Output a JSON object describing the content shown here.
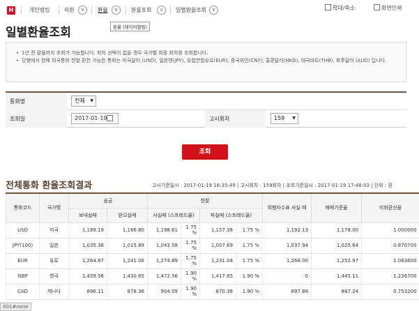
{
  "breadcrumb": {
    "home_icon": "H",
    "items": [
      "개인뱅킹",
      "외환",
      "환율",
      "환율조회",
      "일별환율조회"
    ]
  },
  "tools": {
    "print_zoom": "확대/축소",
    "print": "화면인쇄"
  },
  "tooltip": "환율 (레이어열림)",
  "page_title": "일별환율조회",
  "notices": [
    "1년 전 환율까지 조회가 가능합니다. 회차 선택이 없을 경우 국가별 최종 회차를 조회합니다.",
    "당행에서 현재 외국통화 현찰 환전 가능한 통화는 미국달러 (USD), 일본엔(JPY), 유럽연합유로(EUR), 중국위안(CNY), 홍콩달러(HKD), 태국바트(THB), 호주달러 (AUD) 입니다."
  ],
  "form": {
    "currency_label": "통화명",
    "currency_value": "전체",
    "date_label": "조회일",
    "date_value": "2017-01-19",
    "round_label": "고시회차",
    "round_value": "159"
  },
  "search_button": "조회",
  "result": {
    "title": "전체통화 환율조회결과",
    "meta": "고시기준일시 : 2017-01-19 16:35:49 | 고시회차 : 159회차 | 조회기준일시 : 2017-01-19 17:48:03 | 단위 : 원"
  },
  "table": {
    "h_code": "통화코드",
    "h_country": "국가명",
    "h_remit": "송금",
    "h_cash": "현찰",
    "h_tc": "여행자수표 사실 때",
    "h_base": "매매기준율",
    "h_usd": "미화환산율",
    "h_send": "보내실때",
    "h_receive": "받으실때",
    "h_buy": "사실때 (스프레드율)",
    "h_sell": "파실때 (스프레드율)",
    "rows": [
      [
        "USD",
        "미국",
        "1,189.19",
        "1,166.80",
        "1,198.61",
        "1.75 %",
        "1,157.38",
        "1.75 %",
        "1,192.13",
        "1,178.00",
        "1.000000"
      ],
      [
        "JPY(100)",
        "일본",
        "1,035.38",
        "1,015.89",
        "1,043.58",
        "1.75 %",
        "1,007.69",
        "1.75 %",
        "1,037.94",
        "1,025.64",
        "0.870700"
      ],
      [
        "EUR",
        "유로",
        "1,264.87",
        "1,241.06",
        "1,274.89",
        "1.75 %",
        "1,231.04",
        "1.75 %",
        "1,268.00",
        "1,252.97",
        "1.063600"
      ],
      [
        "GBP",
        "영국",
        "1,459.56",
        "1,430.65",
        "1,472.56",
        "1.90 %",
        "1,417.65",
        "1.90 %",
        "0",
        "1,445.11",
        "1.226700"
      ],
      [
        "CAD",
        "캐나다",
        "896.11",
        "878.36",
        "904.09",
        "1.90 %",
        "870.38",
        "1.90 %",
        "897.88",
        "887.24",
        "0.753200"
      ]
    ]
  },
  "status_text": "001#none"
}
